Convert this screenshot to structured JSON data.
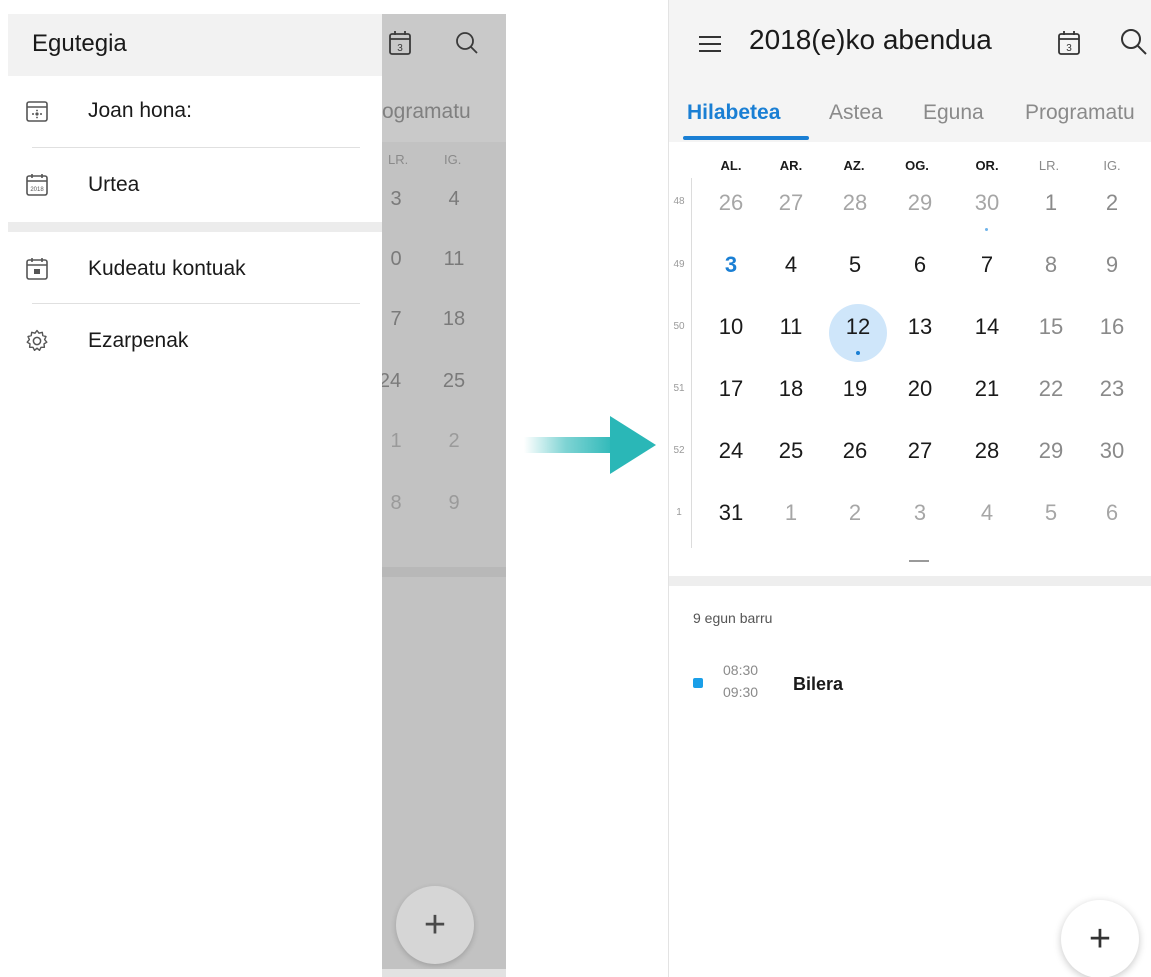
{
  "left": {
    "drawer": {
      "title": "Egutegia",
      "items": [
        {
          "label": "Joan hona:",
          "icon": "calendar-goto-icon"
        },
        {
          "label": "Urtea",
          "icon": "calendar-year-icon"
        },
        {
          "label": "Kudeatu kontuak",
          "icon": "calendar-accounts-icon"
        },
        {
          "label": "Ezarpenak",
          "icon": "gear-icon"
        }
      ]
    },
    "background": {
      "tab_partial": "ogramatu",
      "day_headers": [
        "LR.",
        "IG."
      ],
      "rows": [
        [
          "3",
          "4"
        ],
        [
          "0",
          "11"
        ],
        [
          "7",
          "18"
        ],
        [
          "24",
          "25"
        ],
        [
          "1",
          "2"
        ],
        [
          "8",
          "9"
        ]
      ],
      "fab_label": "+",
      "cal_icon_number": "3"
    }
  },
  "right": {
    "title": "2018(e)ko abendua",
    "cal_icon_number": "3",
    "tabs": [
      {
        "label": "Hilabetea",
        "active": true
      },
      {
        "label": "Astea",
        "active": false
      },
      {
        "label": "Eguna",
        "active": false
      },
      {
        "label": "Programatu",
        "active": false
      }
    ],
    "weekdays": [
      "AL.",
      "AR.",
      "AZ.",
      "OG.",
      "OR.",
      "LR.",
      "IG."
    ],
    "weeks": [
      {
        "number": "48",
        "days": [
          "26",
          "27",
          "28",
          "29",
          "30",
          "1",
          "2"
        ]
      },
      {
        "number": "49",
        "days": [
          "3",
          "4",
          "5",
          "6",
          "7",
          "8",
          "9"
        ]
      },
      {
        "number": "50",
        "days": [
          "10",
          "11",
          "12",
          "13",
          "14",
          "15",
          "16"
        ]
      },
      {
        "number": "51",
        "days": [
          "17",
          "18",
          "19",
          "20",
          "21",
          "22",
          "23"
        ]
      },
      {
        "number": "52",
        "days": [
          "24",
          "25",
          "26",
          "27",
          "28",
          "29",
          "30"
        ]
      },
      {
        "number": "1",
        "days": [
          "31",
          "1",
          "2",
          "3",
          "4",
          "5",
          "6"
        ]
      }
    ],
    "today": "12",
    "agenda": {
      "heading": "9 egun barru",
      "event": {
        "start": "08:30",
        "end": "09:30",
        "title": "Bilera",
        "color": "#1a9fe8"
      }
    },
    "fab_label": "+"
  },
  "colors": {
    "accent": "#1a7fd4",
    "arrow": "#2ab7b7",
    "today_bg": "#cfe6fa"
  }
}
